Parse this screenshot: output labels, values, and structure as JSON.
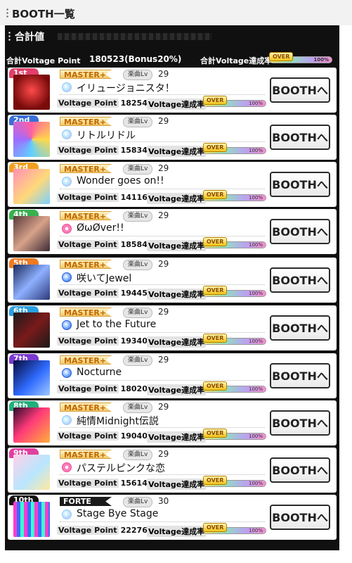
{
  "header": {
    "title": "BOOTH一覧"
  },
  "summary": {
    "section_label": "合計値",
    "voltage_point_label": "合計Voltage Point",
    "voltage_point_value": "180523(Bonus20%)",
    "rate_label": "合計Voltage達成率",
    "over_label": "OVER",
    "percent": "100%",
    "fill": 1.0
  },
  "labels": {
    "lv": "楽曲Lv",
    "voltage_point": "Voltage Point",
    "rate": "Voltage達成率",
    "over": "OVER",
    "percent": "100%",
    "booth_button": "BOOTHへ"
  },
  "colors": {
    "gold": "#f3c86b",
    "rank_1": "#e0406a",
    "rank_2": "#3a6fd8",
    "rank_3": "#f0a020",
    "rank_4": "#39b04f",
    "rank_5": "#f07a20",
    "rank_6": "#2b9fe0",
    "rank_7": "#7a3ad0",
    "rank_8": "#20b07a",
    "rank_9": "#e040a0",
    "rank_10": "#111111"
  },
  "songs": [
    {
      "rank": "1st",
      "difficulty": "MASTER+",
      "level": "29",
      "icon": "heart-gem-icon",
      "title": "イリュージョニスタ！",
      "voltage_point": "18254",
      "fill": 1.0
    },
    {
      "rank": "2nd",
      "difficulty": "MASTER+",
      "level": "29",
      "icon": "heart-gem-icon",
      "title": "リトルリドル",
      "voltage_point": "15834",
      "fill": 1.0
    },
    {
      "rank": "3rd",
      "difficulty": "MASTER+",
      "level": "29",
      "icon": "heart-gem-icon",
      "title": "Wonder goes on!!",
      "voltage_point": "14116",
      "fill": 1.0
    },
    {
      "rank": "4th",
      "difficulty": "MASTER+",
      "level": "29",
      "icon": "flower-icon",
      "title": "ØωØver!!",
      "voltage_point": "18584",
      "fill": 1.0
    },
    {
      "rank": "5th",
      "difficulty": "MASTER+",
      "level": "29",
      "icon": "diamond-icon",
      "title": "咲いてJewel",
      "voltage_point": "19445",
      "fill": 1.0
    },
    {
      "rank": "6th",
      "difficulty": "MASTER+",
      "level": "29",
      "icon": "diamond-icon",
      "title": "Jet to the Future",
      "voltage_point": "19340",
      "fill": 1.0
    },
    {
      "rank": "7th",
      "difficulty": "MASTER+",
      "level": "29",
      "icon": "diamond-icon",
      "title": "Nocturne",
      "voltage_point": "18020",
      "fill": 1.0
    },
    {
      "rank": "8th",
      "difficulty": "MASTER+",
      "level": "29",
      "icon": "heart-gem-icon",
      "title": "純情Midnight伝説",
      "voltage_point": "19040",
      "fill": 1.0
    },
    {
      "rank": "9th",
      "difficulty": "MASTER+",
      "level": "29",
      "icon": "flower-icon",
      "title": "パステルピンクな恋",
      "voltage_point": "15614",
      "fill": 1.0
    },
    {
      "rank": "10th",
      "difficulty": "FORTE",
      "level": "30",
      "icon": "heart-gem-icon",
      "title": "Stage Bye Stage",
      "voltage_point": "22276",
      "fill": 1.0
    }
  ]
}
